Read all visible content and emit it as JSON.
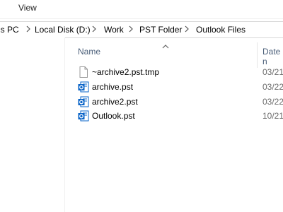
{
  "ribbon": {
    "view_tab": "View"
  },
  "breadcrumb": [
    "is PC",
    "Local Disk (D:)",
    "Work",
    "PST Folder",
    "Outlook Files"
  ],
  "columns": {
    "name": "Name",
    "date": "Date n"
  },
  "files": [
    {
      "name": "~archive2.pst.tmp",
      "date": "03/21",
      "icon": "blank-file-icon"
    },
    {
      "name": "archive.pst",
      "date": "03/22",
      "icon": "outlook-data-file-icon"
    },
    {
      "name": "archive2.pst",
      "date": "03/22",
      "icon": "outlook-data-file-icon"
    },
    {
      "name": "Outlook.pst",
      "date": "10/21",
      "icon": "outlook-data-file-icon"
    }
  ],
  "colors": {
    "header_text": "#4c607a",
    "outlook_blue": "#0a64c8",
    "date_text": "#6d6d6d"
  }
}
